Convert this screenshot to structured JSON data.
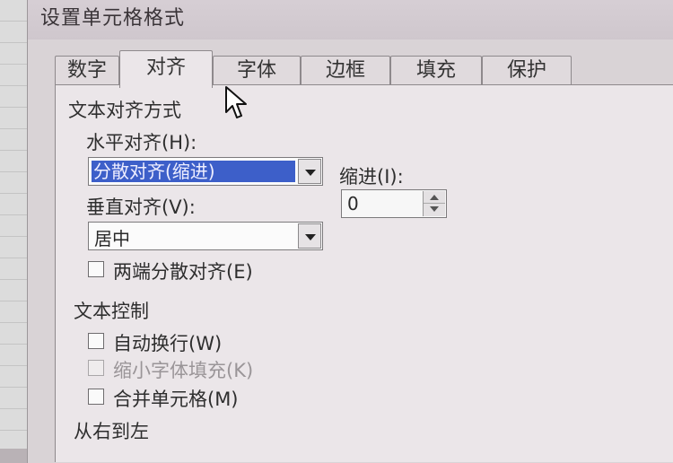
{
  "dialog": {
    "title": "设置单元格格式"
  },
  "tabs": [
    {
      "label": "数字",
      "active": false
    },
    {
      "label": "对齐",
      "active": true
    },
    {
      "label": "字体",
      "active": false
    },
    {
      "label": "边框",
      "active": false
    },
    {
      "label": "填充",
      "active": false
    },
    {
      "label": "保护",
      "active": false
    }
  ],
  "text_alignment": {
    "group_label": "文本对齐方式",
    "horizontal_label": "水平对齐(H):",
    "horizontal_value": "分散对齐(缩进)",
    "indent_label": "缩进(I):",
    "indent_value": "0",
    "vertical_label": "垂直对齐(V):",
    "vertical_value": "居中",
    "justify_distributed_label": "两端分散对齐(E)"
  },
  "text_control": {
    "group_label": "文本控制",
    "wrap_text_label": "自动换行(W)",
    "shrink_to_fit_label": "缩小字体填充(K)",
    "merge_cells_label": "合并单元格(M)"
  },
  "rtl": {
    "group_label": "从右到左"
  },
  "icons": {
    "cursor": "mouse-pointer-icon",
    "dropdown": "chevron-down-icon"
  },
  "colors": {
    "selection": "#3d5fc9",
    "dialog_bg": "#ebe6e9"
  }
}
